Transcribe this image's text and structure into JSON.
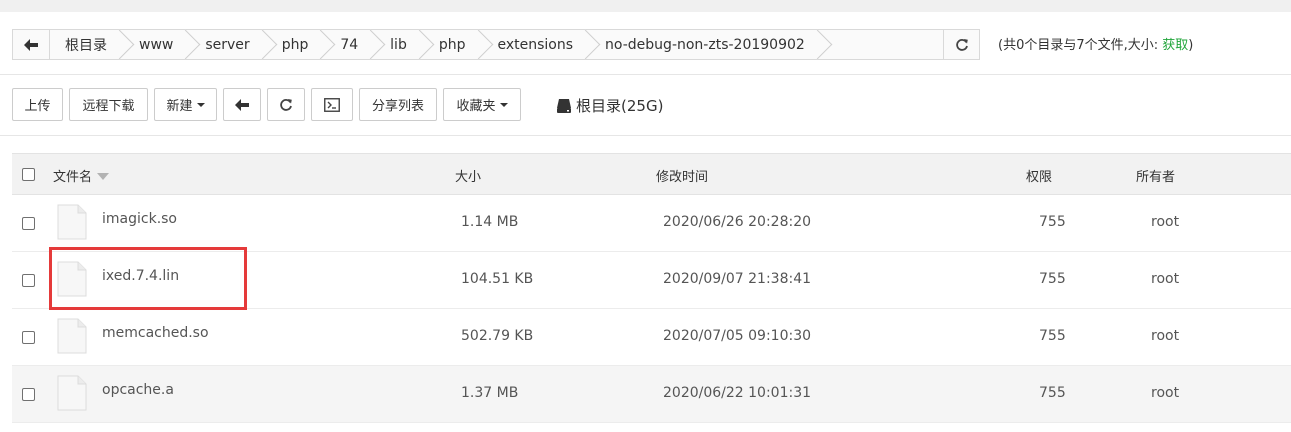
{
  "breadcrumb": {
    "items": [
      "根目录",
      "www",
      "server",
      "php",
      "74",
      "lib",
      "php",
      "extensions",
      "no-debug-non-zts-20190902"
    ],
    "summary_prefix": "(共0个目录与7个文件,大小:",
    "summary_link": "获取",
    "summary_suffix": ")"
  },
  "toolbar": {
    "upload": "上传",
    "remote_download": "远程下载",
    "new": "新建",
    "share_list": "分享列表",
    "favorites": "收藏夹",
    "disk": "根目录(25G)"
  },
  "table": {
    "headers": {
      "name": "文件名",
      "size": "大小",
      "modified": "修改时间",
      "permission": "权限",
      "owner": "所有者"
    },
    "rows": [
      {
        "name": "imagick.so",
        "size": "1.14 MB",
        "modified": "2020/06/26 20:28:20",
        "permission": "755",
        "owner": "root"
      },
      {
        "name": "ixed.7.4.lin",
        "size": "104.51 KB",
        "modified": "2020/09/07 21:38:41",
        "permission": "755",
        "owner": "root"
      },
      {
        "name": "memcached.so",
        "size": "502.79 KB",
        "modified": "2020/07/05 09:10:30",
        "permission": "755",
        "owner": "root"
      },
      {
        "name": "opcache.a",
        "size": "1.37 MB",
        "modified": "2020/06/22 10:01:31",
        "permission": "755",
        "owner": "root"
      }
    ]
  },
  "colors": {
    "accent_green": "#20a53a",
    "highlight_red": "#e53a3a"
  }
}
